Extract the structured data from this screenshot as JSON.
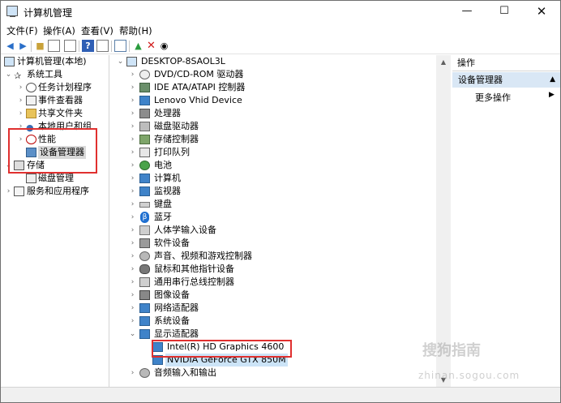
{
  "window": {
    "title": "计算机管理"
  },
  "menu": [
    "文件(F)",
    "操作(A)",
    "查看(V)",
    "帮助(H)"
  ],
  "left_tree": {
    "root": "计算机管理(本地)",
    "system_tools": "系统工具",
    "task_scheduler": "任务计划程序",
    "event_viewer": "事件查看器",
    "shared_folders": "共享文件夹",
    "local_users": "本地用户和组",
    "performance": "性能",
    "device_manager": "设备管理器",
    "storage": "存储",
    "disk_management": "磁盘管理",
    "services_apps": "服务和应用程序"
  },
  "devices": {
    "computer": "DESKTOP-8SAOL3L",
    "categories": [
      "DVD/CD-ROM 驱动器",
      "IDE ATA/ATAPI 控制器",
      "Lenovo Vhid Device",
      "处理器",
      "磁盘驱动器",
      "存储控制器",
      "打印队列",
      "电池",
      "计算机",
      "监视器",
      "键盘",
      "蓝牙",
      "人体学输入设备",
      "软件设备",
      "声音、视频和游戏控制器",
      "鼠标和其他指针设备",
      "通用串行总线控制器",
      "图像设备",
      "网络适配器",
      "系统设备",
      "显示适配器"
    ],
    "display_children": [
      "Intel(R) HD Graphics 4600",
      "NVIDIA GeForce GTX 850M"
    ],
    "after": "音频输入和输出"
  },
  "actions": {
    "header": "操作",
    "selected": "设备管理器",
    "more": "更多操作"
  },
  "watermark": {
    "main": "搜狗指南",
    "url": "zhinan.sogou.com"
  }
}
